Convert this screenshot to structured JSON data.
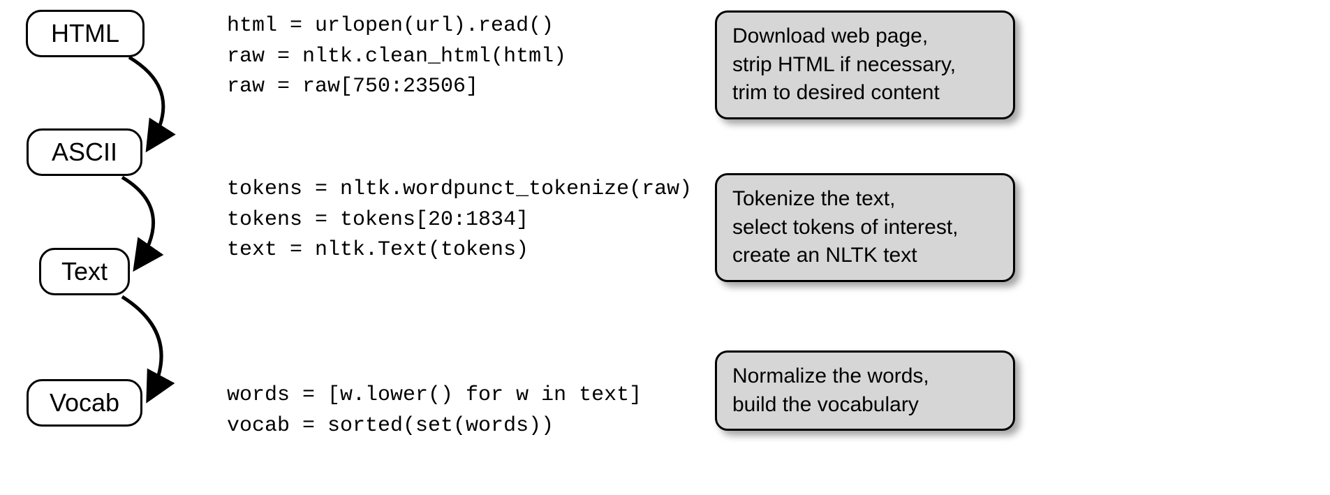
{
  "nodes": {
    "html": "HTML",
    "ascii": "ASCII",
    "text": "Text",
    "vocab": "Vocab"
  },
  "code": {
    "block1": "html = urlopen(url).read()\nraw = nltk.clean_html(html)\nraw = raw[750:23506]",
    "block2": "tokens = nltk.wordpunct_tokenize(raw)\ntokens = tokens[20:1834]\ntext = nltk.Text(tokens)",
    "block3": "words = [w.lower() for w in text]\nvocab = sorted(set(words))"
  },
  "desc": {
    "box1": "Download web page,\nstrip HTML if necessary,\ntrim to desired content",
    "box2": "Tokenize the text,\nselect tokens of interest,\ncreate an NLTK text",
    "box3": "Normalize the words,\nbuild the vocabulary"
  }
}
